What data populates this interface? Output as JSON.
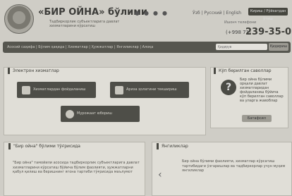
{
  "header": {
    "brand": "«БИР ОЙНА» бўлими",
    "tagline": "Тадбиркорлик субъектларига давлат хизматларини кўрсатиш",
    "language": "Ўзб | Русский | English",
    "login": "Кириш / Рўйхатдан ўтиш",
    "hotline_label": "Ишонч телефони",
    "phone_prefix": "(+998 71)",
    "phone": "239-35-08"
  },
  "nav": {
    "items": "Асосий саҳифа | Бўлим ҳақида | Хизматлар | Ҳужжатлар | Янгиликлар | Алоқа",
    "search_placeholder": "Қидирув",
    "search_button": "Қидириш"
  },
  "electronic": {
    "title": "Электрон хизматлар",
    "services": [
      "Хизматлардан фойдаланиш",
      "Ариза ҳолатини текшириш",
      "Мурожаат юбориш"
    ]
  },
  "faq": {
    "title": "Кўп берилган саволлар",
    "text": "Бир ойна бўлими орқали давлат хизматларидан фойдаланиш бўйича кўп берилган саволлар ва уларга жавоблар",
    "button": "Батафсил"
  },
  "about": {
    "title": "\"Бир ойна\" бўлими тўғрисида",
    "text": "\"Бир ойна\" тамойили асосида тадбиркорлик субъектларига давлат хизматларини кўрсатиш бўйича бўлим фаолияти, ҳужжатларни қабул қилиш ва беришнинг ягона тартиби тўғрисида маълумот"
  },
  "news": {
    "title": "Янгиликлар",
    "text": "Бир ойна бўлими фаолияти, хизматлар кўрсатиш тартибидаги ўзгаришлар ва тадбиркорлар учун муҳим янгиликлар"
  },
  "icons": {
    "emblem": "state-emblem-icon",
    "faq": "question-mark-icon",
    "prev": "chevron-left-icon"
  }
}
